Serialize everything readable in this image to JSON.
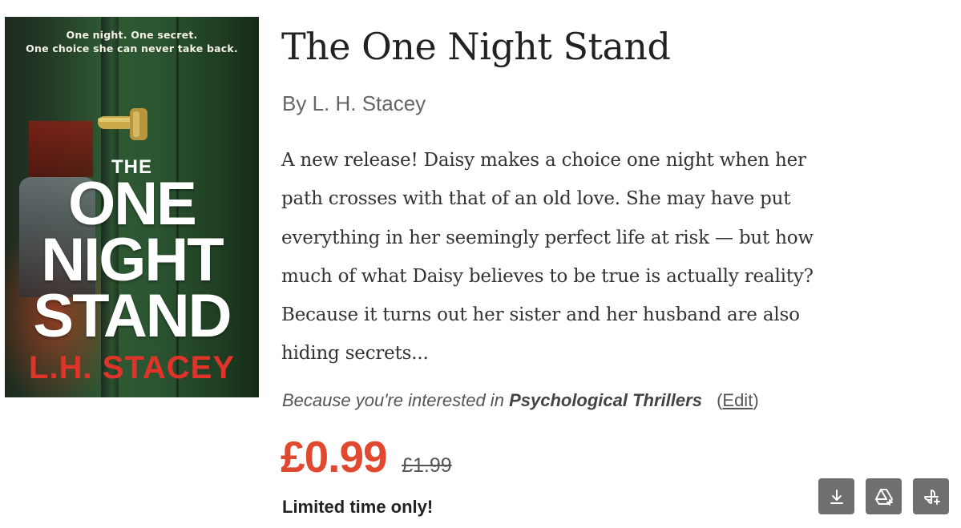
{
  "cover": {
    "tagline_line1": "One night. One secret.",
    "tagline_line2": "One choice she can never take back.",
    "title_the": "THE",
    "title_one": "ONE",
    "title_night": "NIGHT",
    "title_stand": "STAND",
    "author": "L.H. STACEY"
  },
  "book": {
    "title": "The One Night Stand",
    "byline": "By L. H. Stacey",
    "description_lines": [
      "A new release! Daisy makes a choice one night when her",
      "path crosses with that of an old love. She may have put",
      "everything in her seemingly perfect life at risk — but how",
      "much of what Daisy believes to be true is actually reality?",
      "Because it turns out her sister and her husband are also",
      "hiding secrets..."
    ]
  },
  "interest": {
    "lead": "Because you're interested in",
    "genre": "Psychological Thrillers",
    "open_paren": "(",
    "edit_label": "Edit",
    "close_paren": ")"
  },
  "pricing": {
    "current": "£0.99",
    "original": "£1.99",
    "note": "Limited time only!"
  },
  "actions": [
    {
      "icon": "download-icon"
    },
    {
      "icon": "add-to-drive-icon"
    },
    {
      "icon": "add-to-photos-icon"
    }
  ],
  "colors": {
    "price_accent": "#e0492f",
    "cover_author_red": "#e0332a",
    "cover_green": "#2f5a34",
    "action_button_bg": "#6f6f6f"
  }
}
